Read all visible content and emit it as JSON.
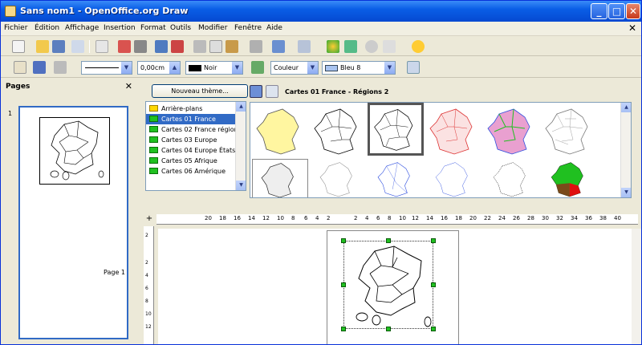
{
  "window": {
    "title": "Sans nom1 - OpenOffice.org Draw"
  },
  "menu": [
    "Fichier",
    "Édition",
    "Affichage",
    "Insertion",
    "Format",
    "Outils",
    "Modifier",
    "Fenêtre",
    "Aide"
  ],
  "line_toolbar": {
    "line_width": "0,00cm",
    "line_color": "Noir",
    "area_style": "Couleur",
    "area_color": "Bleu 8"
  },
  "pages_panel": {
    "title": "Pages",
    "page_number": "1",
    "page_label": "Page 1"
  },
  "gallery": {
    "new_theme_button": "Nouveau thème...",
    "title": "Cartes 01 France  - Régions 2",
    "themes": [
      {
        "label": "Arrière-plans",
        "selected": false
      },
      {
        "label": "Cartes 01 France",
        "selected": true
      },
      {
        "label": "Cartes 02 France régions",
        "selected": false
      },
      {
        "label": "Cartes 03 Europe",
        "selected": false
      },
      {
        "label": "Cartes 04 Europe États",
        "selected": false
      },
      {
        "label": "Cartes 05 Afrique",
        "selected": false
      },
      {
        "label": "Cartes 06 Amérique",
        "selected": false
      }
    ],
    "selected_thumbnail": 3,
    "colors": {
      "yellow": "#fff6a0",
      "green": "#20c020",
      "brown": "#7a4a1a",
      "red": "#e01010",
      "blue": "#3050e0"
    }
  },
  "ruler": {
    "h_ticks": [
      "20",
      "18",
      "16",
      "14",
      "12",
      "10",
      "8",
      "6",
      "4",
      "2",
      "",
      "2",
      "4",
      "6",
      "8",
      "10",
      "12",
      "14",
      "16",
      "18",
      "20",
      "22",
      "24",
      "26",
      "28",
      "30",
      "32",
      "34",
      "36",
      "38",
      "40"
    ],
    "v_ticks": [
      "2",
      "",
      "2",
      "4",
      "6",
      "8",
      "10",
      "12"
    ]
  }
}
